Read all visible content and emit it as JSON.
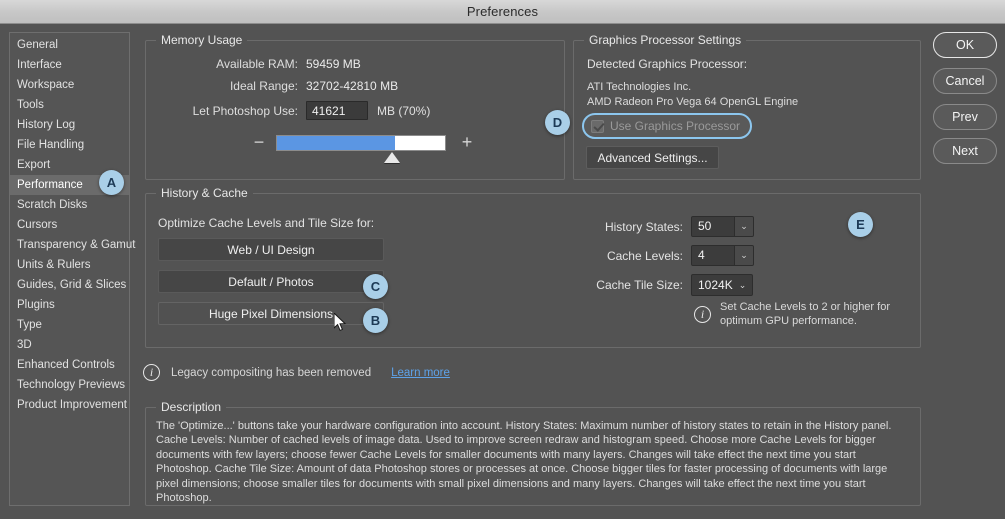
{
  "window": {
    "title": "Preferences"
  },
  "sidebar": {
    "items": [
      {
        "label": "General",
        "selected": false
      },
      {
        "label": "Interface",
        "selected": false
      },
      {
        "label": "Workspace",
        "selected": false
      },
      {
        "label": "Tools",
        "selected": false
      },
      {
        "label": "History Log",
        "selected": false
      },
      {
        "label": "File Handling",
        "selected": false
      },
      {
        "label": "Export",
        "selected": false
      },
      {
        "label": "Performance",
        "selected": true
      },
      {
        "label": "Scratch Disks",
        "selected": false
      },
      {
        "label": "Cursors",
        "selected": false
      },
      {
        "label": "Transparency & Gamut",
        "selected": false
      },
      {
        "label": "Units & Rulers",
        "selected": false
      },
      {
        "label": "Guides, Grid & Slices",
        "selected": false
      },
      {
        "label": "Plugins",
        "selected": false
      },
      {
        "label": "Type",
        "selected": false
      },
      {
        "label": "3D",
        "selected": false
      },
      {
        "label": "Enhanced Controls",
        "selected": false
      },
      {
        "label": "Technology Previews",
        "selected": false
      },
      {
        "label": "Product Improvement",
        "selected": false
      }
    ]
  },
  "memory": {
    "group_title": "Memory Usage",
    "available_ram_label": "Available RAM:",
    "available_ram_value": "59459 MB",
    "ideal_range_label": "Ideal Range:",
    "ideal_range_value": "32702-42810 MB",
    "let_use_label": "Let Photoshop Use:",
    "let_use_value": "41621",
    "let_use_suffix": "MB (70%)",
    "slider_percent": 70,
    "minus_label": "−",
    "plus_label": "+"
  },
  "gpu": {
    "group_title": "Graphics Processor Settings",
    "detected_label": "Detected Graphics Processor:",
    "vendor": "ATI Technologies Inc.",
    "model": "AMD Radeon Pro Vega 64 OpenGL Engine",
    "use_gpu_label": "Use Graphics Processor",
    "use_gpu_checked": true,
    "use_gpu_disabled": true,
    "advanced_button": "Advanced Settings..."
  },
  "history_cache": {
    "group_title": "History & Cache",
    "optimize_label": "Optimize Cache Levels and Tile Size for:",
    "buttons": [
      {
        "label": "Web / UI Design"
      },
      {
        "label": "Default / Photos"
      },
      {
        "label": "Huge Pixel Dimensions"
      }
    ],
    "history_states_label": "History States:",
    "history_states_value": "50",
    "cache_levels_label": "Cache Levels:",
    "cache_levels_value": "4",
    "cache_tile_label": "Cache Tile Size:",
    "cache_tile_value": "1024K",
    "gpu_note": "Set Cache Levels to 2 or higher for\noptimum GPU performance.",
    "info_glyph": "i",
    "chevron": "⌄"
  },
  "legacy": {
    "text": "Legacy compositing has been removed",
    "link": "Learn more",
    "info_glyph": "i"
  },
  "description": {
    "group_title": "Description",
    "body": "The 'Optimize...' buttons take your hardware configuration into account.\nHistory States: Maximum number of history states to retain in the History panel.\nCache Levels: Number of cached levels of image data.  Used to improve screen redraw and histogram speed.  Choose more Cache Levels for bigger documents with few layers; choose fewer Cache Levels for smaller documents with many layers. Changes will take effect the next time you start Photoshop.\nCache Tile Size: Amount of data Photoshop stores or processes at once. Choose bigger tiles for faster processing of documents with large pixel dimensions; choose smaller tiles for documents with small pixel dimensions and many layers. Changes will take effect the next time you start Photoshop."
  },
  "actions": {
    "ok": "OK",
    "cancel": "Cancel",
    "prev": "Prev",
    "next": "Next"
  },
  "annotations": {
    "a": "A",
    "b": "B",
    "c": "C",
    "d": "D",
    "e": "E"
  },
  "colors": {
    "accent_blue": "#5b96e3",
    "badge_blue": "#a9cfe8",
    "link_blue": "#5ea2e8",
    "dialog_bg": "#535353",
    "highlight_ring": "#8cc6ee"
  }
}
